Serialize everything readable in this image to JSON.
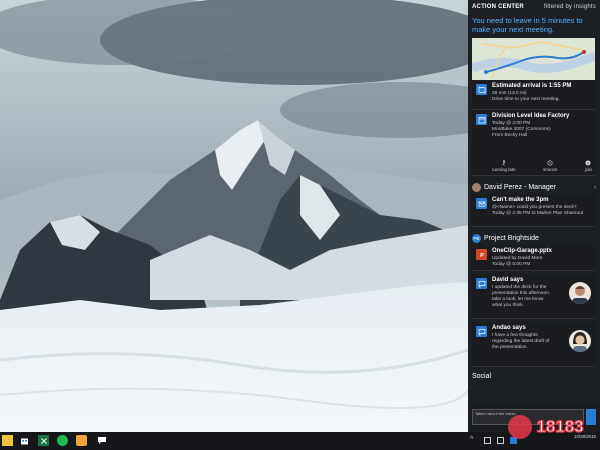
{
  "action_center": {
    "title": "ACTION CENTER",
    "filter": "filtered by insights",
    "message": "You need to leave in 5 minutes to make your next meeting.",
    "route": {
      "title": "Estimated arrival is 1:55 PM",
      "line1": "28 min (13.0 mi)",
      "line2": "Drive time to your next meeting."
    },
    "calendar": {
      "title": "Division Level Idea Factory",
      "line1": "Today @ 2:00 PM",
      "line2": "MonBake 2007 (Commons)",
      "line3": "From Becky Hall",
      "actions": [
        "running late",
        "snooze",
        "join"
      ]
    },
    "group1": {
      "name": "David Perez - Manager"
    },
    "mail": {
      "title": "Can't make the 3pm",
      "line1": "@<Name> could you present the deck?",
      "line2": "Today @ 2:35 PM to Market Plan Shareout"
    },
    "group2": {
      "name": "Project Brightside",
      "badge": "PB"
    },
    "onenote": {
      "title": "OneClip-Garage.pptx",
      "line1": "Updated by David More",
      "line2": "Today @ 5:00 PM"
    },
    "chat1": {
      "title": "David says",
      "line1": "I updated the deck for the",
      "line2": "presentation this afternoon,",
      "line3": "take a look, let me know",
      "line4": "what you think."
    },
    "chat2": {
      "title": "Andao says",
      "line1": "I have a few thoughts",
      "line2": "regarding the latest draft of",
      "line3": "the presentation."
    },
    "social": {
      "title": "Social",
      "input": "Talked about the latest..."
    }
  },
  "taskbar": {
    "icons": [
      "file-explorer-icon",
      "store-icon",
      "excel-icon",
      "spotify-icon",
      "outlook-icon",
      "messaging-icon"
    ],
    "date": "10/28/2015"
  },
  "watermark": {
    "text": "18183"
  },
  "colors": {
    "accent": "#2b7cd3",
    "message": "#4fb3ff"
  }
}
